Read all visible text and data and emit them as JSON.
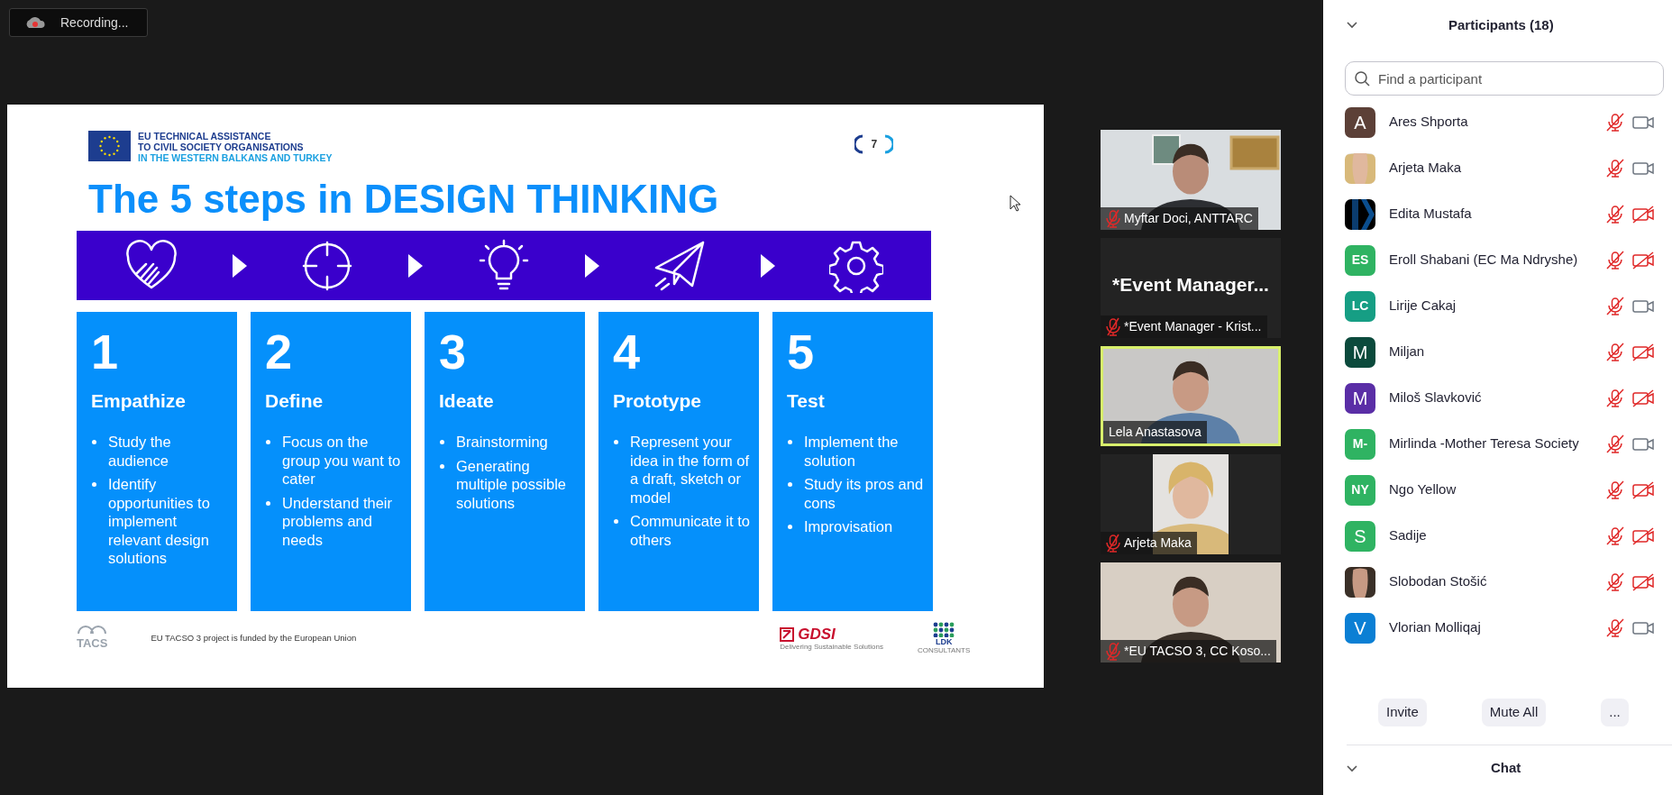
{
  "recording": {
    "label": "Recording..."
  },
  "slide": {
    "logo_lines": [
      {
        "text": "EU TECHNICAL ASSISTANCE",
        "accent": false
      },
      {
        "text": "TO CIVIL SOCIETY ORGANISATIONS",
        "accent": false
      },
      {
        "text": "IN THE WESTERN BALKANS AND TURKEY",
        "accent": true
      }
    ],
    "page_number": "7",
    "title": "The 5 steps in DESIGN THINKING",
    "steps": [
      {
        "number": "1",
        "title": "Empathize",
        "points": [
          "Study the audience",
          "Identify opportunities to implement relevant design solutions"
        ]
      },
      {
        "number": "2",
        "title": "Define",
        "points": [
          "Focus on the group you want to cater",
          "Understand their problems and needs"
        ]
      },
      {
        "number": "3",
        "title": "Ideate",
        "points": [
          "Brainstorming",
          "Generating multiple possible solutions"
        ]
      },
      {
        "number": "4",
        "title": "Prototype",
        "points": [
          "Represent your idea in the form of a draft, sketch or model",
          "Communicate it to others"
        ]
      },
      {
        "number": "5",
        "title": "Test",
        "points": [
          "Implement the solution",
          "Study its pros and cons",
          "Improvisation"
        ]
      }
    ],
    "footer": {
      "logo_text": "TACS",
      "funding": "EU TACSO 3 project is funded by the European Union",
      "partners": [
        {
          "name": "GDSI",
          "tagline": "Delivering Sustainable Solutions"
        },
        {
          "name": "LDK",
          "tagline": "CONSULTANTS"
        }
      ]
    }
  },
  "video_tiles": [
    {
      "kind": "video",
      "name": "Myftar Doci, ANTTARC",
      "muted": true,
      "active": false
    },
    {
      "kind": "name",
      "display_name": "*Event  Manager...",
      "name": "*Event Manager - Krist...",
      "muted": true,
      "active": false
    },
    {
      "kind": "video",
      "name": "Lela Anastasova",
      "muted": false,
      "active": true
    },
    {
      "kind": "portrait",
      "name": "Arjeta Maka",
      "muted": true,
      "active": false
    },
    {
      "kind": "video",
      "name": "*EU TACSO 3, CC Koso...",
      "muted": true,
      "active": false
    }
  ],
  "participants": {
    "title": "Participants (18)",
    "search": {
      "placeholder": "Find a participant"
    },
    "list": [
      {
        "name": "Ares Shporta",
        "avatar": {
          "kind": "initials",
          "text": "A",
          "color": "#5c4037"
        },
        "mic_muted": true,
        "video_on": true
      },
      {
        "name": "Arjeta Maka",
        "mic_muted": true,
        "video_on": true
      },
      {
        "name": "Edita Mustafa",
        "avatar": {
          "kind": "logo"
        },
        "mic_muted": true,
        "video_on": false
      },
      {
        "name": "Eroll Shabani (EC Ma Ndryshe)",
        "avatar": {
          "kind": "initials",
          "text": "ES",
          "color": "#2fb362"
        },
        "mic_muted": true,
        "video_on": false
      },
      {
        "name": "Lirije Cakaj",
        "avatar": {
          "kind": "initials",
          "text": "LC",
          "color": "#169e84"
        },
        "mic_muted": true,
        "video_on": true
      },
      {
        "name": "Miljan",
        "avatar": {
          "kind": "initials",
          "text": "M",
          "color": "#0b4a3c"
        },
        "mic_muted": true,
        "video_on": false
      },
      {
        "name": "Miloš Slavković",
        "avatar": {
          "kind": "initials",
          "text": "M",
          "color": "#5a2ea6"
        },
        "mic_muted": true,
        "video_on": false
      },
      {
        "name": "Mirlinda -Mother Teresa Society",
        "avatar": {
          "kind": "initials",
          "text": "M-",
          "color": "#2fb362"
        },
        "mic_muted": true,
        "video_on": true
      },
      {
        "name": "Ngo Yellow",
        "avatar": {
          "kind": "initials",
          "text": "NY",
          "color": "#2fb362"
        },
        "mic_muted": true,
        "video_on": false
      },
      {
        "name": "Sadije",
        "avatar": {
          "kind": "initials",
          "text": "S",
          "color": "#2fb362"
        },
        "mic_muted": true,
        "video_on": false
      },
      {
        "name": "Slobodan Stošić",
        "mic_muted": true,
        "video_on": false
      },
      {
        "name": "Vlorian Molliqaj",
        "avatar": {
          "kind": "initials",
          "text": "V",
          "color": "#0b7fd4"
        },
        "mic_muted": true,
        "video_on": true
      }
    ],
    "buttons": [
      "Invite",
      "Mute All",
      "..."
    ]
  },
  "chat": {
    "title": "Chat"
  }
}
